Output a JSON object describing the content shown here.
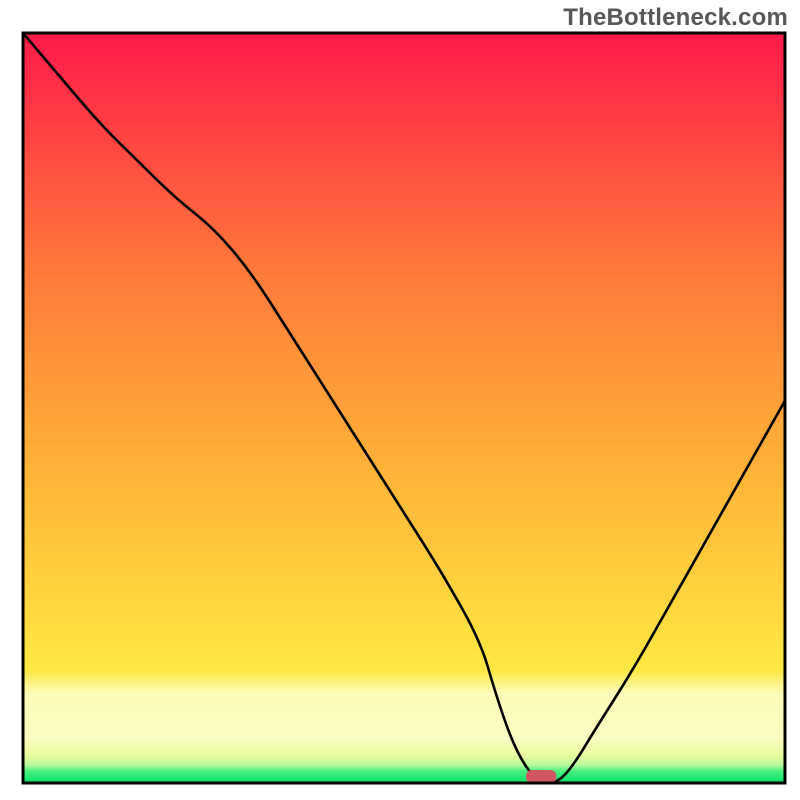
{
  "watermark": "TheBottleneck.com",
  "chart_data": {
    "type": "line",
    "title": "",
    "xlabel": "",
    "ylabel": "",
    "xlim": [
      0,
      100
    ],
    "ylim": [
      0,
      100
    ],
    "x": [
      0,
      5,
      10,
      15,
      20,
      25,
      30,
      35,
      40,
      45,
      50,
      55,
      60,
      62,
      64,
      66,
      68,
      70,
      72,
      75,
      80,
      85,
      90,
      95,
      100
    ],
    "values": [
      100,
      94,
      88,
      83,
      78,
      74,
      68,
      60,
      52,
      44,
      36,
      28,
      19,
      12,
      6,
      2,
      0,
      0,
      2,
      7,
      15,
      24,
      33,
      42,
      51
    ],
    "note": "Values are the bottleneck-percentage curve; ~67 on the x-axis is the optimal point (green zone, curve touches zero). A small red pill marker sits on the x-axis at x≈66–70.",
    "gradient_bands": [
      {
        "name": "green",
        "color_start": "#03e36a",
        "color_end": "#8df7a0",
        "y_range": [
          0,
          2.2
        ]
      },
      {
        "name": "pale-green-yellow",
        "color_start": "#cdfba0",
        "color_end": "#f6fca7",
        "y_range": [
          2.2,
          5
        ]
      },
      {
        "name": "pale-yellow",
        "color_start": "#fbfdc2",
        "color_end": "#fdfcb8",
        "y_range": [
          5,
          13
        ]
      },
      {
        "name": "yellow-orange-red",
        "color_start": "#ffe843",
        "color_end": "#ff1a4a",
        "y_range": [
          13,
          100
        ]
      }
    ],
    "marker": {
      "x_start": 66,
      "x_end": 70,
      "y": 0,
      "color": "#cf5763"
    }
  }
}
